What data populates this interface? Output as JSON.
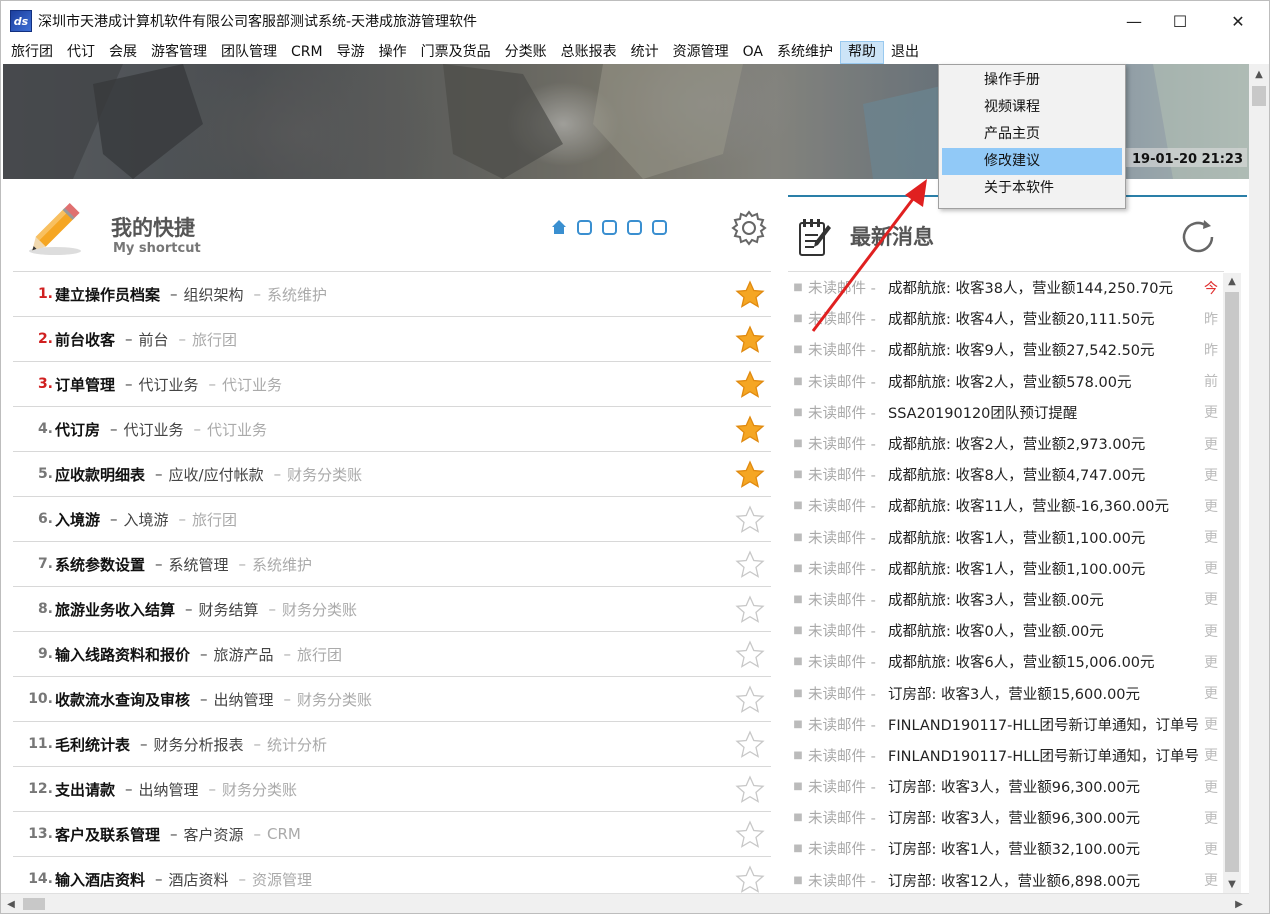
{
  "window": {
    "title": "深圳市天港成计算机软件有限公司客服部测试系统-天港成旅游管理软件",
    "icon_name": "app-logo-icon",
    "icon_text": "ds",
    "minimize_glyph": "—",
    "maximize_glyph": "☐",
    "close_glyph": "✕"
  },
  "menubar": {
    "items": [
      "旅行团",
      "代订",
      "会展",
      "游客管理",
      "团队管理",
      "CRM",
      "导游",
      "操作",
      "门票及货品",
      "分类账",
      "总账报表",
      "统计",
      "资源管理",
      "OA",
      "系统维护",
      "帮助",
      "退出"
    ],
    "active_index": 15
  },
  "help_menu": {
    "items": [
      "操作手册",
      "视频课程",
      "产品主页",
      "修改建议",
      "关于本软件"
    ],
    "hover_index": 3
  },
  "banner": {
    "operator_info": "操作员　　　　　　　　19-01-20  21:23"
  },
  "shortcut": {
    "title": "我的快捷",
    "subtitle": "My shortcut",
    "page_count": 4,
    "items": [
      {
        "num": "1.",
        "name": "建立操作员档案",
        "module": "组织架构",
        "category": "系统维护",
        "starred": true,
        "red": true
      },
      {
        "num": "2.",
        "name": "前台收客",
        "module": "前台",
        "category": "旅行团",
        "starred": true,
        "red": true
      },
      {
        "num": "3.",
        "name": "订单管理",
        "module": "代订业务",
        "category": "代订业务",
        "starred": true,
        "red": true
      },
      {
        "num": "4.",
        "name": "代订房",
        "module": "代订业务",
        "category": "代订业务",
        "starred": true,
        "red": false
      },
      {
        "num": "5.",
        "name": "应收款明细表",
        "module": "应收/应付帐款",
        "category": "财务分类账",
        "starred": true,
        "red": false
      },
      {
        "num": "6.",
        "name": "入境游",
        "module": "入境游",
        "category": "旅行团",
        "starred": false,
        "red": false
      },
      {
        "num": "7.",
        "name": "系统参数设置",
        "module": "系统管理",
        "category": "系统维护",
        "starred": false,
        "red": false
      },
      {
        "num": "8.",
        "name": "旅游业务收入结算",
        "module": "财务结算",
        "category": "财务分类账",
        "starred": false,
        "red": false
      },
      {
        "num": "9.",
        "name": "输入线路资料和报价",
        "module": "旅游产品",
        "category": "旅行团",
        "starred": false,
        "red": false
      },
      {
        "num": "10.",
        "name": "收款流水查询及审核",
        "module": "出纳管理",
        "category": "财务分类账",
        "starred": false,
        "red": false
      },
      {
        "num": "11.",
        "name": "毛利统计表",
        "module": "财务分析报表",
        "category": "统计分析",
        "starred": false,
        "red": false
      },
      {
        "num": "12.",
        "name": "支出请款",
        "module": "出纳管理",
        "category": "财务分类账",
        "starred": false,
        "red": false
      },
      {
        "num": "13.",
        "name": "客户及联系管理",
        "module": "客户资源",
        "category": "CRM",
        "starred": false,
        "red": false
      },
      {
        "num": "14.",
        "name": "输入酒店资料",
        "module": "酒店资料",
        "category": "资源管理",
        "starred": false,
        "red": false
      }
    ],
    "separator": "–"
  },
  "news": {
    "title": "最新消息",
    "items": [
      {
        "tag": "未读邮件 -",
        "text": "成都航旅: 收客38人，营业额144,250.70元",
        "date": "今",
        "today": true
      },
      {
        "tag": "未读邮件 -",
        "text": "成都航旅: 收客4人，营业额20,111.50元",
        "date": "昨",
        "today": false
      },
      {
        "tag": "未读邮件 -",
        "text": "成都航旅: 收客9人，营业额27,542.50元",
        "date": "昨",
        "today": false
      },
      {
        "tag": "未读邮件 -",
        "text": "成都航旅: 收客2人，营业额578.00元",
        "date": "前",
        "today": false
      },
      {
        "tag": "未读邮件 -",
        "text": "SSA20190120团队预订提醒",
        "date": "更",
        "today": false
      },
      {
        "tag": "未读邮件 -",
        "text": "成都航旅: 收客2人，营业额2,973.00元",
        "date": "更",
        "today": false
      },
      {
        "tag": "未读邮件 -",
        "text": "成都航旅: 收客8人，营业额4,747.00元",
        "date": "更",
        "today": false
      },
      {
        "tag": "未读邮件 -",
        "text": "成都航旅: 收客11人，营业额-16,360.00元",
        "date": "更",
        "today": false
      },
      {
        "tag": "未读邮件 -",
        "text": "成都航旅: 收客1人，营业额1,100.00元",
        "date": "更",
        "today": false
      },
      {
        "tag": "未读邮件 -",
        "text": "成都航旅: 收客1人，营业额1,100.00元",
        "date": "更",
        "today": false
      },
      {
        "tag": "未读邮件 -",
        "text": "成都航旅: 收客3人，营业额.00元",
        "date": "更",
        "today": false
      },
      {
        "tag": "未读邮件 -",
        "text": "成都航旅: 收客0人，营业额.00元",
        "date": "更",
        "today": false
      },
      {
        "tag": "未读邮件 -",
        "text": "成都航旅: 收客6人，营业额15,006.00元",
        "date": "更",
        "today": false
      },
      {
        "tag": "未读邮件 -",
        "text": "订房部: 收客3人，营业额15,600.00元",
        "date": "更",
        "today": false
      },
      {
        "tag": "未读邮件 -",
        "text": "FINLAND190117-HLL团号新订单通知，订单号",
        "date": "更",
        "today": false
      },
      {
        "tag": "未读邮件 -",
        "text": "FINLAND190117-HLL团号新订单通知，订单号",
        "date": "更",
        "today": false
      },
      {
        "tag": "未读邮件 -",
        "text": "订房部: 收客3人，营业额96,300.00元",
        "date": "更",
        "today": false
      },
      {
        "tag": "未读邮件 -",
        "text": "订房部: 收客3人，营业额96,300.00元",
        "date": "更",
        "today": false
      },
      {
        "tag": "未读邮件 -",
        "text": "订房部: 收客1人，营业额32,100.00元",
        "date": "更",
        "today": false
      },
      {
        "tag": "未读邮件 -",
        "text": "订房部: 收客12人，营业额6,898.00元",
        "date": "更",
        "today": false
      }
    ]
  },
  "colors": {
    "accent_blue": "#3a8fd0",
    "menu_active": "#cce4f7",
    "dropdown_hover": "#91c9f7",
    "star_gold": "#f5a623",
    "red_number": "#d02020",
    "annotation_red": "#e02020"
  }
}
